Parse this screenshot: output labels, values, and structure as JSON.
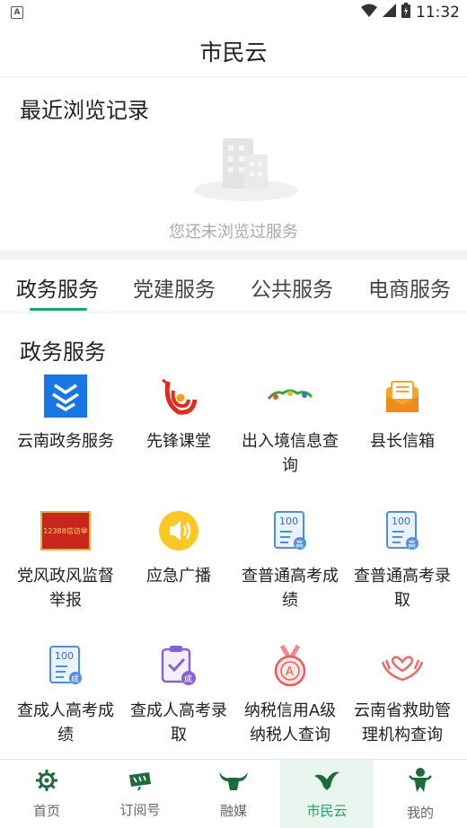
{
  "status_bar": {
    "time": "11:32",
    "badge": "A"
  },
  "header": {
    "title": "市民云"
  },
  "recent": {
    "title": "最近浏览记录",
    "empty_text": "您还未浏览过服务"
  },
  "tabs": [
    {
      "label": "政务服务"
    },
    {
      "label": "党建服务"
    },
    {
      "label": "公共服务"
    },
    {
      "label": "电商服务"
    }
  ],
  "section": {
    "title": "政务服务"
  },
  "services": [
    {
      "label": "云南政务服务",
      "icon": "yunnan-gov-service-icon"
    },
    {
      "label": "先锋课堂",
      "icon": "pioneer-class-icon"
    },
    {
      "label": "出入境信息查询",
      "icon": "immigration-info-icon"
    },
    {
      "label": "县长信箱",
      "icon": "mailbox-icon"
    },
    {
      "label": "党风政风监督举报",
      "icon": "report-banner-icon",
      "banner_text": "12388信访举"
    },
    {
      "label": "应急广播",
      "icon": "speaker-icon"
    },
    {
      "label": "查普通高考成绩",
      "icon": "exam-score-icon",
      "badge": "100",
      "mark": "高"
    },
    {
      "label": "查普通高考录取",
      "icon": "exam-admission-icon",
      "badge": "100",
      "mark": "高"
    },
    {
      "label": "查成人高考成绩",
      "icon": "adult-exam-score-icon",
      "badge": "100",
      "mark": "成"
    },
    {
      "label": "查成人高考录取",
      "icon": "adult-exam-admission-icon",
      "mark": "成"
    },
    {
      "label": "纳税信用A级纳税人查询",
      "icon": "tax-medal-icon",
      "mark": "A"
    },
    {
      "label": "云南省救助管理机构查询",
      "icon": "aid-hands-icon"
    }
  ],
  "bottom_nav": [
    {
      "label": "首页",
      "icon": "home-gear-icon"
    },
    {
      "label": "订阅号",
      "icon": "subscribe-icon"
    },
    {
      "label": "融媒",
      "icon": "media-bull-icon"
    },
    {
      "label": "市民云",
      "icon": "citizen-cloud-icon",
      "active": true
    },
    {
      "label": "我的",
      "icon": "profile-figure-icon"
    }
  ],
  "colors": {
    "accent": "#1aa36a"
  }
}
